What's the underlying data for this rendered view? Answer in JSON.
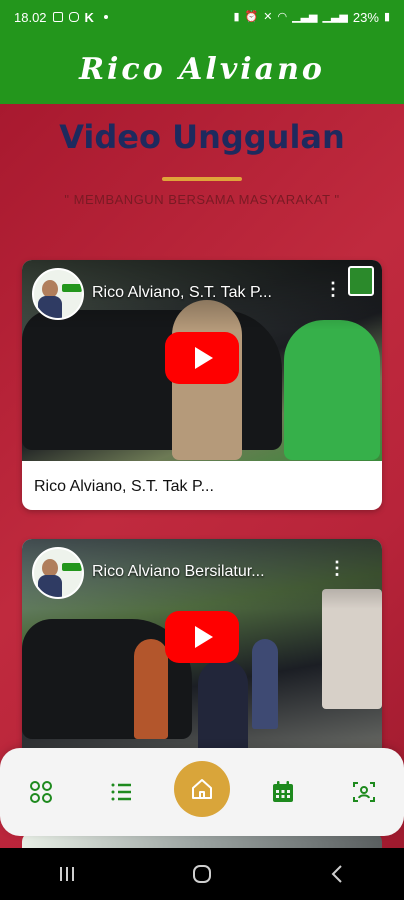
{
  "status_bar": {
    "time": "18.02",
    "battery": "23%"
  },
  "app_bar": {
    "title": "Rico Alviano"
  },
  "section": {
    "title": "Video Unggulan",
    "subtitle": "\" MEMBANGUN BERSAMA MASYARAKAT \""
  },
  "videos": [
    {
      "overlay_title": "Rico Alviano, S.T. Tak P...",
      "caption": "Rico Alviano, S.T. Tak P..."
    },
    {
      "overlay_title": "Rico Alviano Bersilatur..."
    }
  ],
  "bottom_nav": {
    "items": [
      {
        "icon": "grid-icon"
      },
      {
        "icon": "list-icon"
      },
      {
        "icon": "home-icon",
        "active": true
      },
      {
        "icon": "calendar-icon"
      },
      {
        "icon": "scan-user-icon"
      }
    ],
    "active_color": "#d9a53a",
    "icon_color": "#1e8a1e"
  },
  "colors": {
    "header_green": "#23961c",
    "background_red": "#b01e33",
    "title_navy": "#1e2a5e",
    "accent_gold": "#e0a43a"
  }
}
